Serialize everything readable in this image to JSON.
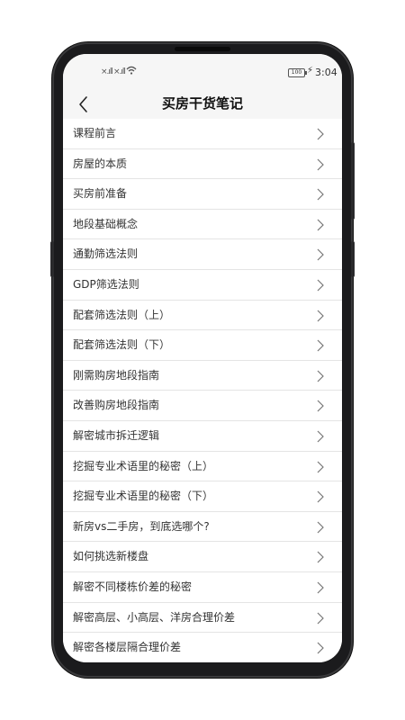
{
  "status_bar": {
    "signal_1": "×.ıll",
    "signal_2": "×.ıll",
    "battery": "100",
    "time": "3:04"
  },
  "header": {
    "title": "买房干货笔记"
  },
  "list": {
    "items": [
      {
        "label": "课程前言"
      },
      {
        "label": "房屋的本质"
      },
      {
        "label": "买房前准备"
      },
      {
        "label": "地段基础概念"
      },
      {
        "label": "通勤筛选法则"
      },
      {
        "label": "GDP筛选法则"
      },
      {
        "label": "配套筛选法则（上）"
      },
      {
        "label": "配套筛选法则（下）"
      },
      {
        "label": "刚需购房地段指南"
      },
      {
        "label": "改善购房地段指南"
      },
      {
        "label": "解密城市拆迁逻辑"
      },
      {
        "label": "挖掘专业术语里的秘密（上）"
      },
      {
        "label": "挖掘专业术语里的秘密（下）"
      },
      {
        "label": "新房vs二手房，到底选哪个?"
      },
      {
        "label": "如何挑选新楼盘"
      },
      {
        "label": "解密不同楼栋价差的秘密"
      },
      {
        "label": "解密高层、小高层、洋房合理价差"
      },
      {
        "label": "解密各楼层隔合理价差"
      }
    ]
  }
}
